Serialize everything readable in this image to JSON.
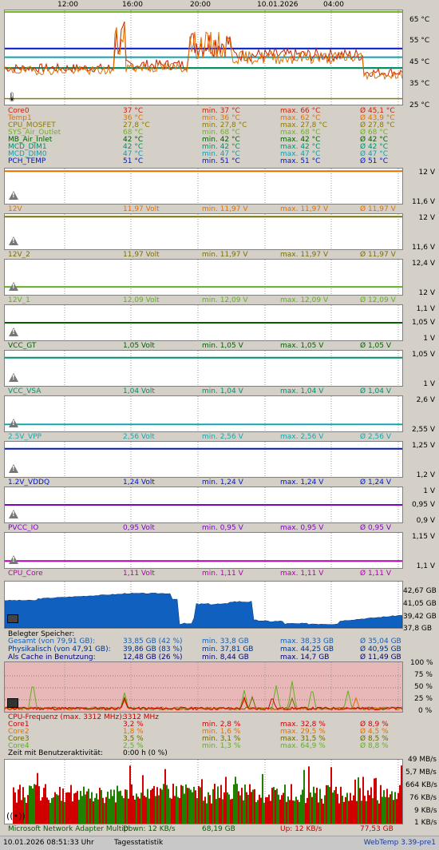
{
  "timeline": {
    "labels": [
      "12:00",
      "16:00",
      "20:00",
      "10.01.2026",
      "04:00"
    ]
  },
  "temperature": {
    "scale": [
      "65 °C",
      "55 °C",
      "45 °C",
      "35 °C",
      "25 °C"
    ],
    "rows": [
      {
        "name": "Core0",
        "cur": "37 °C",
        "min": "min. 37 °C",
        "max": "max. 66 °C",
        "avg": "Ø 45,1 °C",
        "color": "#d02000"
      },
      {
        "name": "Temp1",
        "cur": "36 °C",
        "min": "min. 36 °C",
        "max": "max. 62 °C",
        "avg": "Ø 43,9 °C",
        "color": "#e07000"
      },
      {
        "name": "CPU_MOSFET",
        "cur": "27,8 °C",
        "min": "min. 27,8 °C",
        "max": "max. 27,8 °C",
        "avg": "Ø 27,8 °C",
        "color": "#8a7a00"
      },
      {
        "name": "SYS_Air_Outlet",
        "cur": "68 °C",
        "min": "min. 68 °C",
        "max": "max. 68 °C",
        "avg": "Ø 68 °C",
        "color": "#70b020"
      },
      {
        "name": "MB_Air_Inlet",
        "cur": "42 °C",
        "min": "min. 42 °C",
        "max": "max. 42 °C",
        "avg": "Ø 42 °C",
        "color": "#006000"
      },
      {
        "name": "MCD_DIM1",
        "cur": "42 °C",
        "min": "min. 42 °C",
        "max": "max. 42 °C",
        "avg": "Ø 42 °C",
        "color": "#009070"
      },
      {
        "name": "MCD_DIM0",
        "cur": "47 °C",
        "min": "min. 47 °C",
        "max": "max. 47 °C",
        "avg": "Ø 47 °C",
        "color": "#10a0b0"
      },
      {
        "name": "PCH_TEMP",
        "cur": "51 °C",
        "min": "min. 51 °C",
        "max": "max. 51 °C",
        "avg": "Ø 51 °C",
        "color": "#0018c0"
      }
    ]
  },
  "voltages": [
    {
      "name": "12V",
      "cur": "11,97 Volt",
      "min": "min. 11,97 V",
      "max": "max. 11,97 V",
      "avg": "Ø 11,97 V",
      "top": "12 V",
      "bottom": "11,6 V",
      "color": "#e07000"
    },
    {
      "name": "12V_2",
      "cur": "11,97 Volt",
      "min": "min. 11,97 V",
      "max": "max. 11,97 V",
      "avg": "Ø 11,97 V",
      "top": "12 V",
      "bottom": "11,6 V",
      "color": "#7a7000"
    },
    {
      "name": "12V_1",
      "cur": "12,09 Volt",
      "min": "min. 12,09 V",
      "max": "max. 12,09 V",
      "avg": "Ø 12,09 V",
      "top": "12,4 V",
      "bottom": "12 V",
      "color": "#60b020"
    },
    {
      "name": "VCC_GT",
      "cur": "1,05 Volt",
      "min": "min. 1,05 V",
      "max": "max. 1,05 V",
      "avg": "Ø 1,05 V",
      "top": "1,1 V",
      "bottom": "1 V",
      "mid": "1,05 V",
      "color": "#006000"
    },
    {
      "name": "VCC_VSA",
      "cur": "1,04 Volt",
      "min": "min. 1,04 V",
      "max": "max. 1,04 V",
      "avg": "Ø 1,04 V",
      "top": "1,05 V",
      "bottom": "1 V",
      "color": "#009070"
    },
    {
      "name": "2.5V_VPP",
      "cur": "2,56 Volt",
      "min": "min. 2,56 V",
      "max": "max. 2,56 V",
      "avg": "Ø 2,56 V",
      "top": "2,6 V",
      "bottom": "2,55 V",
      "color": "#10a8b0"
    },
    {
      "name": "1.2V_VDDQ",
      "cur": "1,24 Volt",
      "min": "min. 1,24 V",
      "max": "max. 1,24 V",
      "avg": "Ø 1,24 V",
      "top": "1,25 V",
      "bottom": "1,2 V",
      "color": "#0018c0"
    },
    {
      "name": "PVCC_IO",
      "cur": "0,95 Volt",
      "min": "min. 0,95 V",
      "max": "max. 0,95 V",
      "avg": "Ø 0,95 V",
      "top": "1 V",
      "bottom": "0,9 V",
      "mid": "0,95 V",
      "color": "#8000c0"
    },
    {
      "name": "CPU_Core",
      "cur": "1,11 Volt",
      "min": "min. 1,11 V",
      "max": "max. 1,11 V",
      "avg": "Ø 1,11 V",
      "top": "1,15 V",
      "bottom": "1,1 V",
      "color": "#b000b0"
    }
  ],
  "memory": {
    "scale": [
      "42,67 GB",
      "41,05 GB",
      "39,42 GB",
      "37,8 GB"
    ],
    "header": "Belegter Speicher:",
    "rows": [
      {
        "name": "Gesamt (von 79,91 GB):",
        "cur": "33,85 GB (42 %)",
        "min": "min. 33,8 GB",
        "max": "max. 38,33 GB",
        "avg": "Ø 35,04 GB",
        "color": "#1060c0"
      },
      {
        "name": "Physikalisch (von 47,91 GB):",
        "cur": "39,86 GB (83 %)",
        "min": "min. 37,81 GB",
        "max": "max. 44,25 GB",
        "avg": "Ø 40,95 GB",
        "color": "#003080"
      },
      {
        "name": "Als Cache in Benutzung:",
        "cur": "12,48 GB (26 %)",
        "min": "min. 8,44 GB",
        "max": "max. 14,7 GB",
        "avg": "Ø 11,49 GB",
        "color": "#000080"
      }
    ]
  },
  "cpu": {
    "scale": [
      "100 %",
      "75 %",
      "50 %",
      "25 %",
      "0 %"
    ],
    "header": "CPU-Frequenz (max. 3312 MHz):",
    "header_value": "3312 MHz",
    "rows": [
      {
        "name": "Core1",
        "cur": "3,2 %",
        "min": "min. 2,8 %",
        "max": "max. 32,8 %",
        "avg": "Ø 8,9 %",
        "color": "#d00000"
      },
      {
        "name": "Core2",
        "cur": "1,8 %",
        "min": "min. 1,6 %",
        "max": "max. 29,5 %",
        "avg": "Ø 4,5 %",
        "color": "#e07000"
      },
      {
        "name": "Core3",
        "cur": "3,5 %",
        "min": "min. 3,1 %",
        "max": "max. 31,5 %",
        "avg": "Ø 8,5 %",
        "color": "#6a6a00"
      },
      {
        "name": "Core4",
        "cur": "2,5 %",
        "min": "min. 1,3 %",
        "max": "max. 64,9 %",
        "avg": "Ø 8,8 %",
        "color": "#60b020"
      }
    ],
    "activity_label": "Zeit mit Benutzeraktivität:",
    "activity_value": "0:00 h (0 %)"
  },
  "network": {
    "scale": [
      "49 MB/s",
      "5,7 MB/s",
      "664 KB/s",
      "76 KB/s",
      "9 KB/s",
      "1 KB/s"
    ],
    "adapter": "Microsoft Network Adapter Multipl",
    "down": "Down: 12 KB/s",
    "down_total": "68,19 GB",
    "up": "Up: 12 KB/s",
    "up_total": "77,53 GB"
  },
  "footer": {
    "timestamp": "10.01.2026 08:51:33 Uhr",
    "stats_link": "Tagesstatistik",
    "version": "WebTemp 3.39-pre1"
  }
}
